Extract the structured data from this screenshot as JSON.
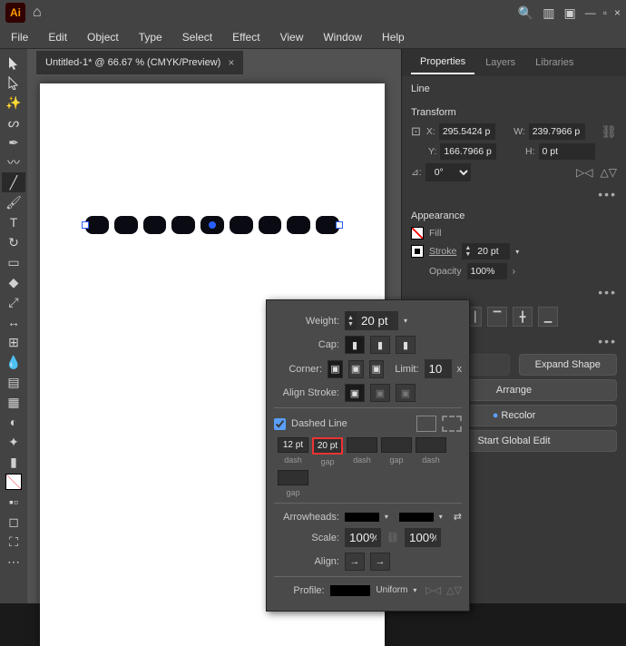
{
  "topbar": {
    "app_badge": "Ai"
  },
  "menubar": {
    "items": [
      "File",
      "Edit",
      "Object",
      "Type",
      "Select",
      "Effect",
      "View",
      "Window",
      "Help"
    ]
  },
  "doc_tab": {
    "label": "Untitled-1* @ 66.67 % (CMYK/Preview)",
    "close": "×"
  },
  "panels": {
    "tabs": [
      "Properties",
      "Layers",
      "Libraries"
    ],
    "active": 0
  },
  "properties": {
    "type_label": "Line",
    "transform_title": "Transform",
    "x_label": "X:",
    "x_value": "295.5424 p",
    "y_label": "Y:",
    "y_value": "166.7966 p",
    "w_label": "W:",
    "w_value": "239.7966 p",
    "h_label": "H:",
    "h_value": "0 pt",
    "rot_label": "⊿:",
    "rot_value": "0°",
    "appearance_title": "Appearance",
    "fill_label": "Fill",
    "stroke_label": "Stroke",
    "stroke_weight": "20 pt",
    "opacity_label": "Opacity",
    "opacity_value": "100%",
    "expand_btn": "Expand Shape",
    "arrange_btn": "Arrange",
    "recolor_btn": "Recolor",
    "global_edit_btn": "Start Global Edit"
  },
  "stroke_panel": {
    "weight_label": "Weight:",
    "weight_value": "20 pt",
    "cap_label": "Cap:",
    "corner_label": "Corner:",
    "limit_label": "Limit:",
    "limit_value": "10",
    "limit_unit": "x",
    "align_stroke_label": "Align Stroke:",
    "dashed_label": "Dashed Line",
    "dashgap": [
      {
        "value": "12 pt",
        "label": "dash"
      },
      {
        "value": "20 pt",
        "label": "gap",
        "hi": true
      },
      {
        "value": "",
        "label": "dash"
      },
      {
        "value": "",
        "label": "gap"
      },
      {
        "value": "",
        "label": "dash"
      },
      {
        "value": "",
        "label": "gap"
      }
    ],
    "arrowheads_label": "Arrowheads:",
    "scale_label": "Scale:",
    "scale1": "100%",
    "scale2": "100%",
    "align_label": "Align:",
    "profile_label": "Profile:",
    "profile_value": "Uniform"
  }
}
